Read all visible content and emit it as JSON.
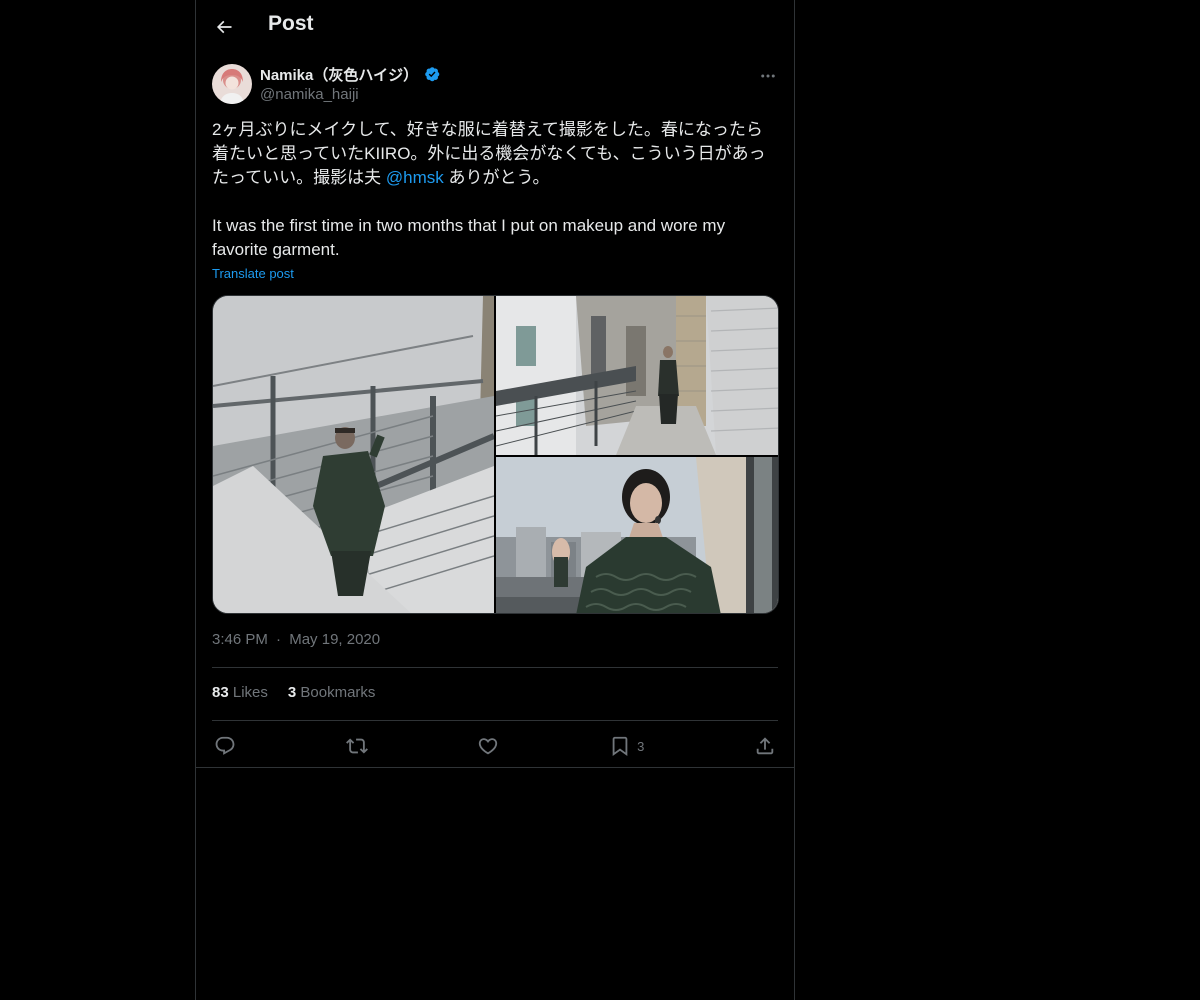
{
  "header": {
    "back_icon": "arrow-left-icon",
    "title": "Post"
  },
  "author": {
    "name": "Namika（灰色ハイジ）",
    "handle": "@namika_haiji",
    "verified_icon": "verified-badge-icon",
    "verified_color": "#1d9bf0"
  },
  "post": {
    "text_ja_1": "2ヶ月ぶりにメイクして、好きな服に着替えて撮影をした。春になったら着たいと思っていたKIIRO。外に出る機会がなくても、こういう日があったっていい。撮影は夫 ",
    "mention": "@hmsk",
    "text_ja_2": " ありがとう。",
    "text_en": "It was the first time in two months that I put on makeup and wore my favorite garment.",
    "translate_label": "Translate post",
    "time": "3:46 PM",
    "separator": "·",
    "date": "May 19, 2020"
  },
  "media": [
    {
      "icon": "photo-stairs"
    },
    {
      "icon": "photo-balcony"
    },
    {
      "icon": "photo-portrait-city"
    }
  ],
  "stats": {
    "likes_count": "83",
    "likes_label": "Likes",
    "bookmarks_count": "3",
    "bookmarks_label": "Bookmarks"
  },
  "actions": {
    "reply_icon": "reply-icon",
    "repost_icon": "repost-icon",
    "like_icon": "heart-icon",
    "bookmark_icon": "bookmark-icon",
    "bookmark_count": "3",
    "share_icon": "share-icon"
  },
  "colors": {
    "background": "#000000",
    "text": "#e7e9ea",
    "muted": "#71767b",
    "accent": "#1d9bf0",
    "border": "#2f3336"
  }
}
